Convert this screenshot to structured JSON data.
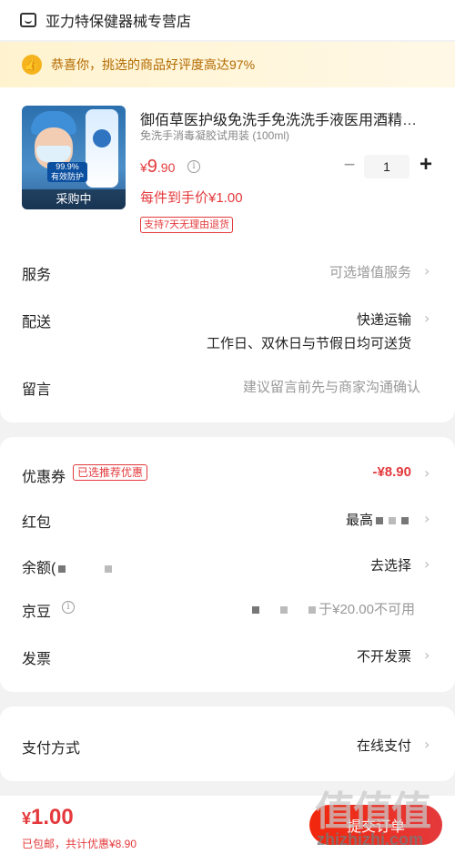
{
  "store": {
    "name": "亚力特保健器械专营店",
    "icon": "store-icon"
  },
  "praise": {
    "text": "恭喜你，挑选的商品好评度高达97%",
    "icon": "thumbs-up-icon"
  },
  "product": {
    "title": "御佰草医护级免洗手免洗洗手液医用酒精…",
    "spec": "免洗手消毒凝胶试用装 (100ml)",
    "price_currency": "¥",
    "price_int": "9",
    "price_dec": ".90",
    "quantity": "1",
    "unit_price_text": "每件到手价¥1.00",
    "return_badge": "支持7天无理由退货",
    "image_badge_line1": "99.9%",
    "image_badge_line2": "有效防护",
    "image_status": "采购中"
  },
  "service": {
    "label": "服务",
    "value": "可选增值服务"
  },
  "delivery": {
    "label": "配送",
    "value": "快递运输",
    "sub": "工作日、双休日与节假日均可送货"
  },
  "message": {
    "label": "留言",
    "placeholder": "建议留言前先与商家沟通确认"
  },
  "coupon": {
    "label": "优惠券",
    "tag": "已选推荐优惠",
    "value": "-¥8.90"
  },
  "red_packet": {
    "label": "红包",
    "value_visible": "最高"
  },
  "balance": {
    "label_visible": "余额(",
    "value": "去选择"
  },
  "jd_beans": {
    "label": "京豆",
    "value_visible": "于¥20.00不可用"
  },
  "invoice": {
    "label": "发票",
    "value": "不开发票"
  },
  "payment": {
    "label": "支付方式",
    "value": "在线支付"
  },
  "bottom": {
    "currency": "¥",
    "amount": "1.00",
    "summary": "已包邮，共计优惠¥8.90",
    "submit_label": "提交订单"
  },
  "watermark": {
    "big": "值值值",
    "small": "zhizhizhi.com"
  },
  "colors": {
    "accent": "#e4393c",
    "praise_bg": "#fff3cf",
    "praise_text": "#b36a00"
  }
}
